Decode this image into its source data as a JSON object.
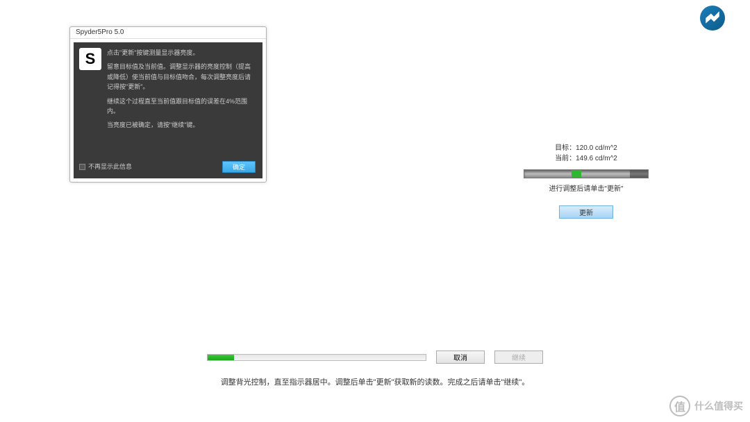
{
  "dialog": {
    "title": "Spyder5Pro 5.0",
    "icon_letter": "S",
    "lines": {
      "l1": "点击\"更新\"按键测量显示器亮度。",
      "l2": "留意目标值及当前值。调整显示器的亮度控制（提高或降低）使当前值与目标值吻合，每次调整亮度后请记得按\"更新\"。",
      "l3": "继续这个过程直至当前值跟目标值的误差在4%范围内。",
      "l4": "当亮度已被确定，请按\"继续\"键。"
    },
    "dont_show": "不再显示此信息",
    "ok": "确定"
  },
  "right": {
    "target_label": "目标：",
    "target_value": "120.0 cd/m^2",
    "current_label": "当前：",
    "current_value": "149.6 cd/m^2",
    "adjust_hint": "进行调整后请单击\"更新\"",
    "refresh": "更新"
  },
  "bottom": {
    "cancel": "取消",
    "continue": "继续",
    "instruction": "调整背光控制，直至指示器居中。调整后单击\"更新\"获取新的读数。完成之后请单击\"继续\"。"
  },
  "watermark": {
    "icon": "值",
    "text": "什么值得买"
  }
}
